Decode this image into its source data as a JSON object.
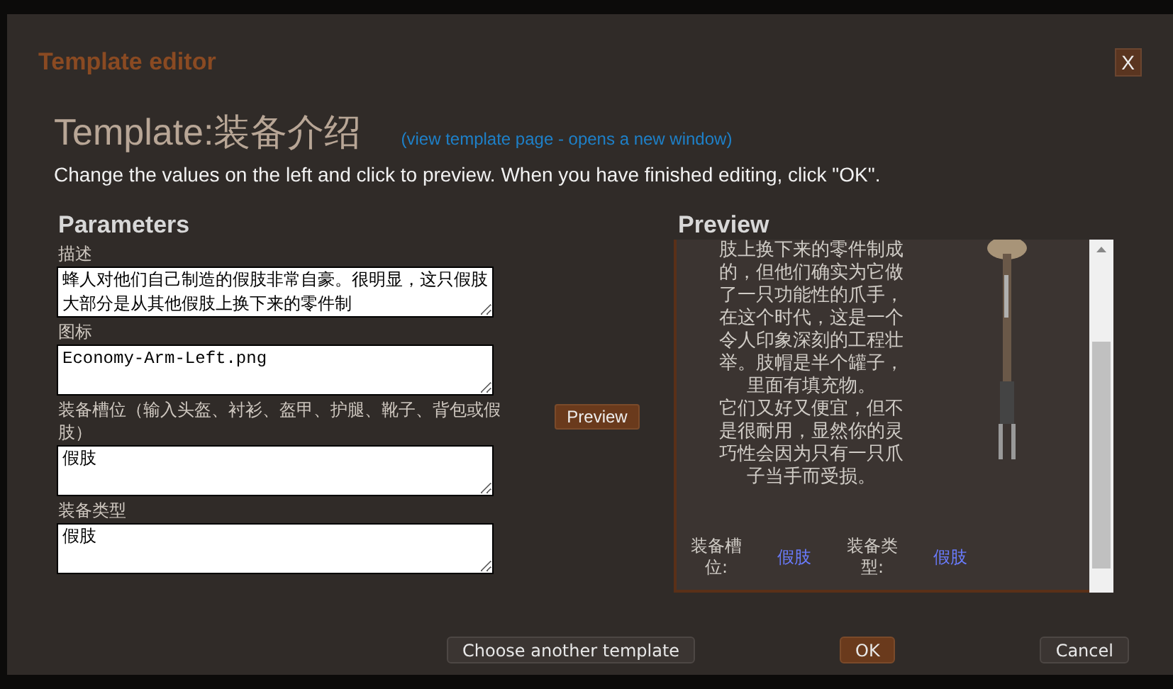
{
  "dialog": {
    "title": "Template editor",
    "close_label": "X"
  },
  "header": {
    "title": "Template:装备介绍",
    "link": "(view template page - opens a new window)",
    "instructions": "Change the values on the left and click to preview. When you have finished editing, click \"OK\"."
  },
  "parameters": {
    "heading": "Parameters",
    "fields": [
      {
        "label": "描述",
        "value": "蜂人对他们自己制造的假肢非常自豪。很明显，这只假肢大部分是从其他假肢上换下来的零件制"
      },
      {
        "label": "图标",
        "value": "Economy-Arm-Left.png"
      },
      {
        "label": "装备槽位（输入头盔、衬衫、盔甲、护腿、靴子、背包或假肢）",
        "value": "假肢"
      },
      {
        "label": "装备类型",
        "value": "假肢"
      }
    ]
  },
  "preview_button": "Preview",
  "preview": {
    "heading": "Preview",
    "paragraphs": [
      "肢上换下来的零件制成的，但他们确实为它做了一只功能性的爪手，在这个时代，这是一个令人印象深刻的工程壮举。肢帽是半个罐子，里面有填充物。",
      "它们又好又便宜，但不是很耐用，显然你的灵巧性会因为只有一只爪子当手而受损。"
    ],
    "infobox": [
      {
        "label": "装备槽位:",
        "value": "假肢"
      },
      {
        "label": "装备类型:",
        "value": "假肢"
      }
    ]
  },
  "buttons": [
    {
      "label": "Choose another template",
      "kind": "default"
    },
    {
      "label": "OK",
      "kind": "primary"
    },
    {
      "label": "Cancel",
      "kind": "default"
    }
  ]
}
